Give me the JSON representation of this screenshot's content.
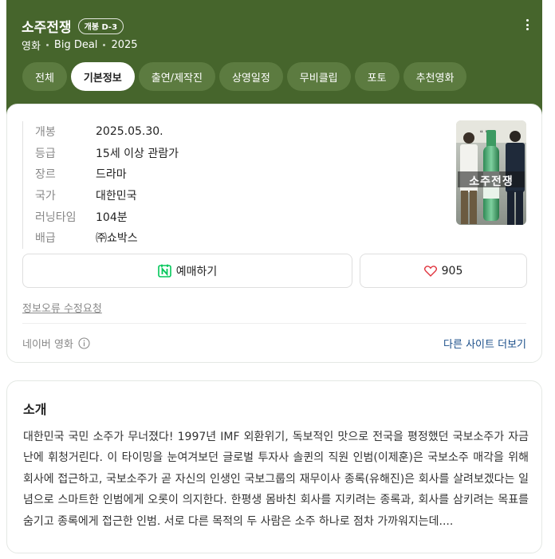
{
  "header": {
    "title": "소주전쟁",
    "badge": "개봉 D-3",
    "meta": [
      "영화",
      "Big Deal",
      "2025"
    ]
  },
  "tabs": [
    {
      "label": "전체",
      "active": false
    },
    {
      "label": "기본정보",
      "active": true
    },
    {
      "label": "출연/제작진",
      "active": false
    },
    {
      "label": "상영일정",
      "active": false
    },
    {
      "label": "무비클립",
      "active": false
    },
    {
      "label": "포토",
      "active": false
    },
    {
      "label": "추천영화",
      "active": false
    }
  ],
  "info": [
    {
      "label": "개봉",
      "value": "2025.05.30."
    },
    {
      "label": "등급",
      "value": "15세 이상 관람가"
    },
    {
      "label": "장르",
      "value": "드라마"
    },
    {
      "label": "국가",
      "value": "대한민국"
    },
    {
      "label": "러닝타임",
      "value": "104분"
    },
    {
      "label": "배급",
      "value": "㈜쇼박스"
    }
  ],
  "poster": {
    "text": "소주전쟁"
  },
  "actions": {
    "reserve_label": "예매하기",
    "like_count": "905"
  },
  "report_label": "정보오류 수정요청",
  "footer": {
    "source": "네이버 영화",
    "more_sites": "다른 사이트 더보기"
  },
  "intro": {
    "title": "소개",
    "text": "대한민국 국민 소주가 무너졌다! 1997년 IMF 외환위기, 독보적인 맛으로 전국을 평정했던 국보소주가 자금난에 휘청거린다. 이 타이밍을 눈여겨보던 글로벌 투자사 솔퀸의 직원 인범(이제훈)은 국보소주 매각을 위해 회사에 접근하고, 국보소주가 곧 자신의 인생인 국보그룹의 재무이사 종록(유해진)은 회사를 살려보겠다는 일념으로 스마트한 인범에게 오롯이 의지한다. 한평생 몸바친 회사를 지키려는 종록과, 회사를 삼키려는 목표를 숨기고 종록에게 접근한 인범. 서로 다른 목적의 두 사람은 소주 하나로 점차 가까워지는데...."
  },
  "colors": {
    "header_bg": "#46652c",
    "tab_bg": "#5c7b40",
    "naver_green": "#03c75a",
    "link_blue": "#1b4f8a",
    "heart_red": "#e0323c"
  }
}
